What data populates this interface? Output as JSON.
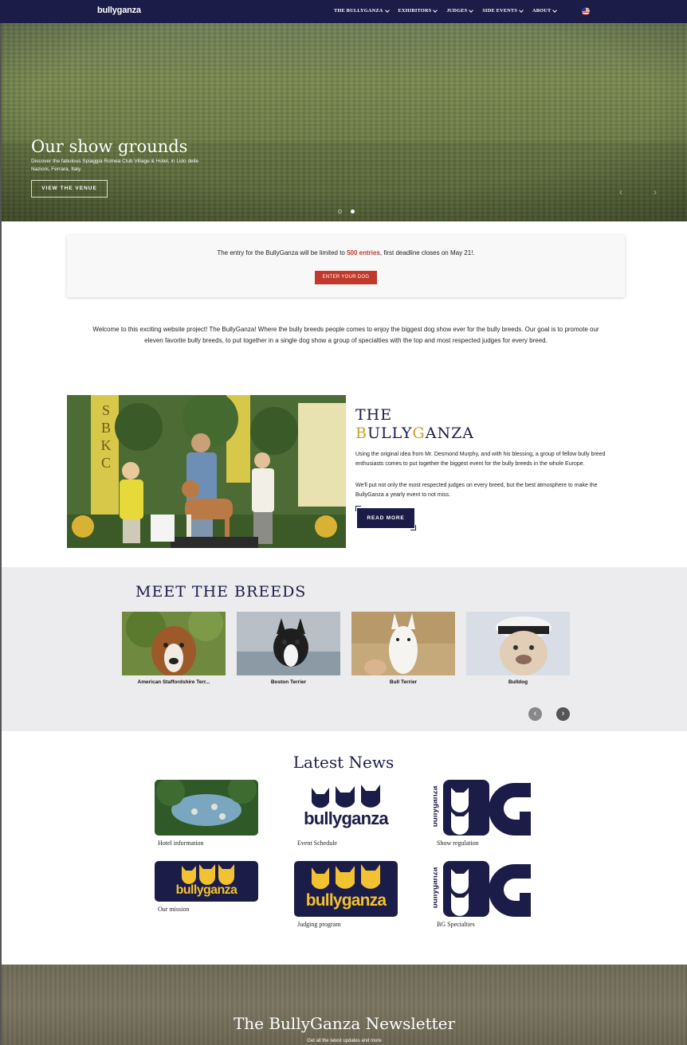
{
  "nav": {
    "logo": "bullyganza",
    "items": [
      "THE BULLYGANZA",
      "EXHIBITORS",
      "JUDGES",
      "SIDE EVENTS",
      "ABOUT"
    ],
    "flag_icon": "us-flag-icon"
  },
  "hero": {
    "title": "Our show grounds",
    "subtitle": "Discover the fabulous Spiaggia Romea Club Village & Hotel, in Lido delle Nazioni, Ferrara, Italy.",
    "button": "VIEW THE VENUE",
    "slide_count": 2,
    "active_slide": 2
  },
  "entry": {
    "text_before": "The entry for the BullyGanza will be limited to ",
    "highlight": "500 entries",
    "text_after": ", first deadline closes on May 21!.",
    "button": "ENTER YOUR DOG",
    "accent": "#c0392b"
  },
  "welcome": "Welcome to this exciting website project! The BullyGanza! Where the bully breeds people comes to enjoy the biggest dog show ever for the bully breeds. Our goal is to promote our eleven favorite bully breeds, to put together in a single dog show a group of specialties with the top and most respected judges for every breed.",
  "about": {
    "title_line1": "THE",
    "title_line2_b": "B",
    "title_line2_ully": "ULLY",
    "title_line2_g": "G",
    "title_line2_anza": "ANZA",
    "p1": "Using the original idea from Mr. Desmond Murphy, and with his blessing, a group of fellow bully breed enthusiasts comes to put together the biggest event for the bully breeds in the whole Europe.",
    "p2": "We'll put not only the most respected judges on every breed, but the best atmosphere to make the BullyGanza a yearly event to not miss.",
    "button": "READ MORE",
    "photo_sign": "SBKC",
    "navy": "#1c1c48",
    "gold": "#c9a227"
  },
  "breeds": {
    "title": "MEET THE BREEDS",
    "items": [
      "American Staffordshire Terr...",
      "Boston Terrier",
      "Bull Terrier",
      "Bulldog"
    ],
    "prev_icon": "chevron-left-icon",
    "next_icon": "chevron-right-icon"
  },
  "news": {
    "title": "Latest News",
    "items": [
      {
        "caption": "Hotel information",
        "logo": ""
      },
      {
        "caption": "Event Schedule",
        "logo": "bullyganza"
      },
      {
        "caption": "Show regulation",
        "logo": "bullyganza"
      },
      {
        "caption": "Our mission",
        "logo": "bullyganza"
      },
      {
        "caption": "Judging program",
        "logo": "bullyganza"
      },
      {
        "caption": "BG Specialties",
        "logo": "bullyganza"
      }
    ]
  },
  "newsletter": {
    "title": "The BullyGanza Newsletter",
    "subtitle": "Get all the latest updates and more"
  }
}
